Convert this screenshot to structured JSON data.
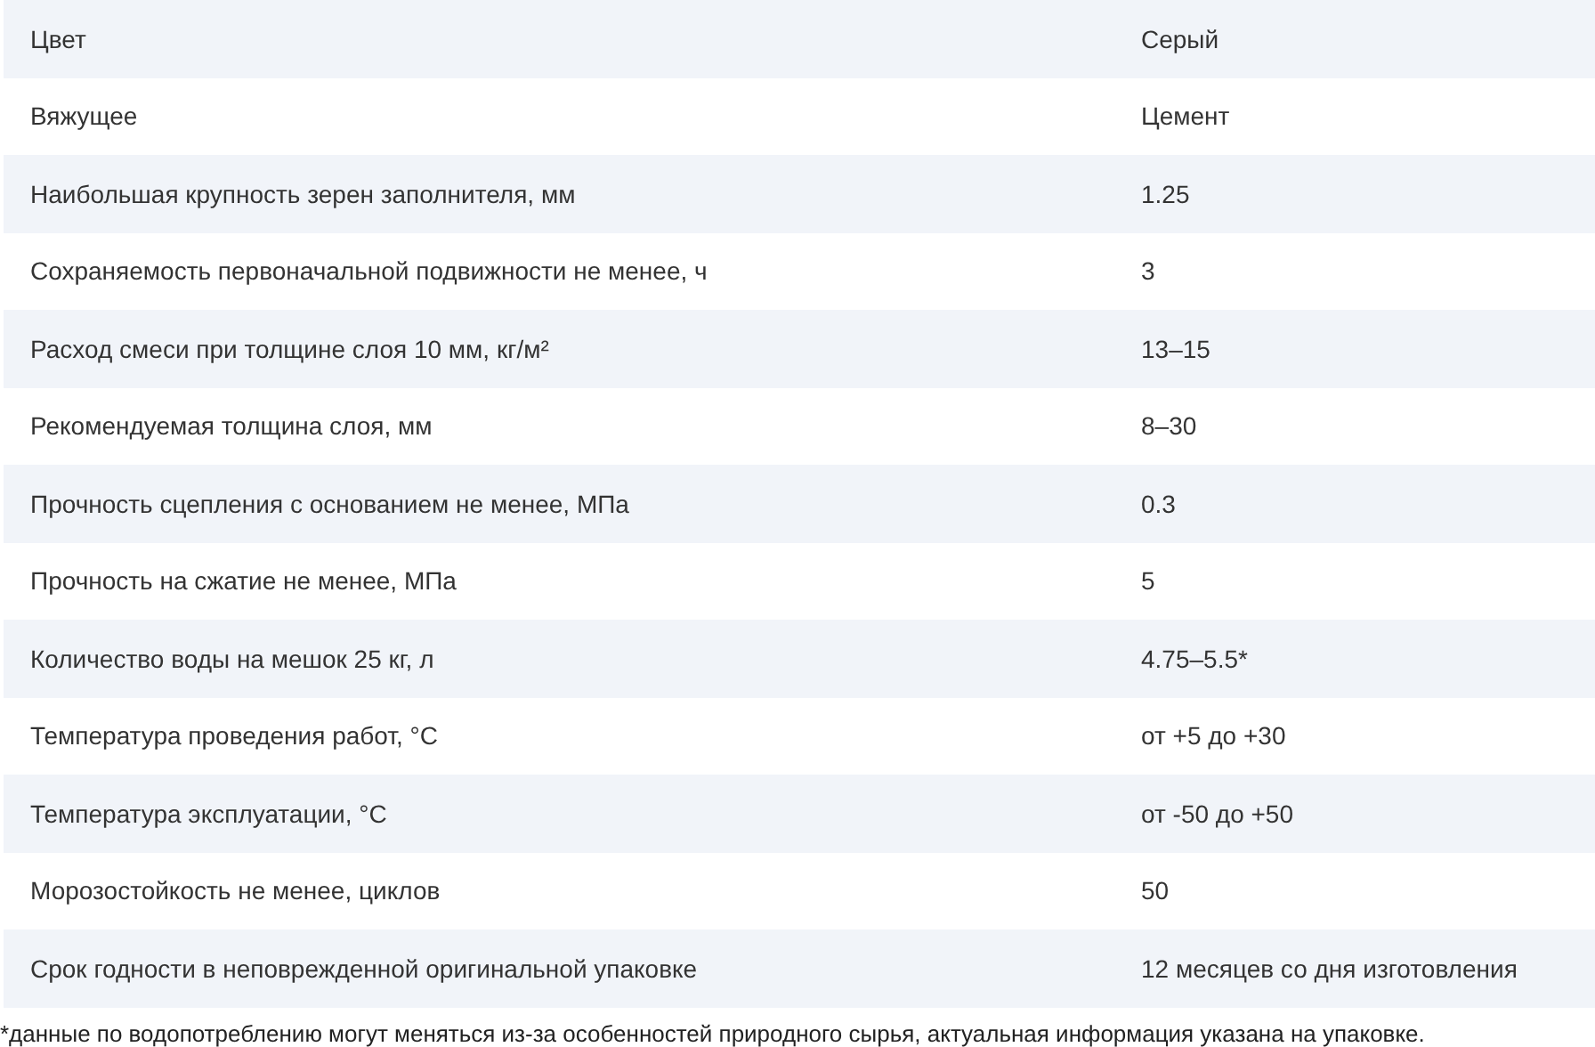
{
  "table": {
    "rows": [
      {
        "label": "Цвет",
        "value": "Серый"
      },
      {
        "label": "Вяжущее",
        "value": "Цемент"
      },
      {
        "label": "Наибольшая крупность зерен заполнителя, мм",
        "value": "1.25"
      },
      {
        "label": "Сохраняемость первоначальной подвижности не менее, ч",
        "value": "3"
      },
      {
        "label": "Расход смеси при толщине слоя 10 мм, кг/м²",
        "value": "13–15"
      },
      {
        "label": "Рекомендуемая толщина слоя, мм",
        "value": "8–30"
      },
      {
        "label": "Прочность сцепления с основанием не менее, МПа",
        "value": "0.3"
      },
      {
        "label": "Прочность на сжатие не менее, МПа",
        "value": "5"
      },
      {
        "label": "Количество воды на мешок 25 кг, л",
        "value": "4.75–5.5*"
      },
      {
        "label": "Температура проведения работ, °C",
        "value": "от +5 до +30"
      },
      {
        "label": "Температура эксплуатации, °C",
        "value": "от -50 до +50"
      },
      {
        "label": "Морозостойкость не менее, циклов",
        "value": "50"
      },
      {
        "label": "Срок годности в неповрежденной оригинальной упаковке",
        "value": "12 месяцев со дня изготовления"
      }
    ]
  },
  "footnote": "*данные по водопотреблению могут меняться из-за особенностей природного сырья, актуальная информация указана на упаковке."
}
